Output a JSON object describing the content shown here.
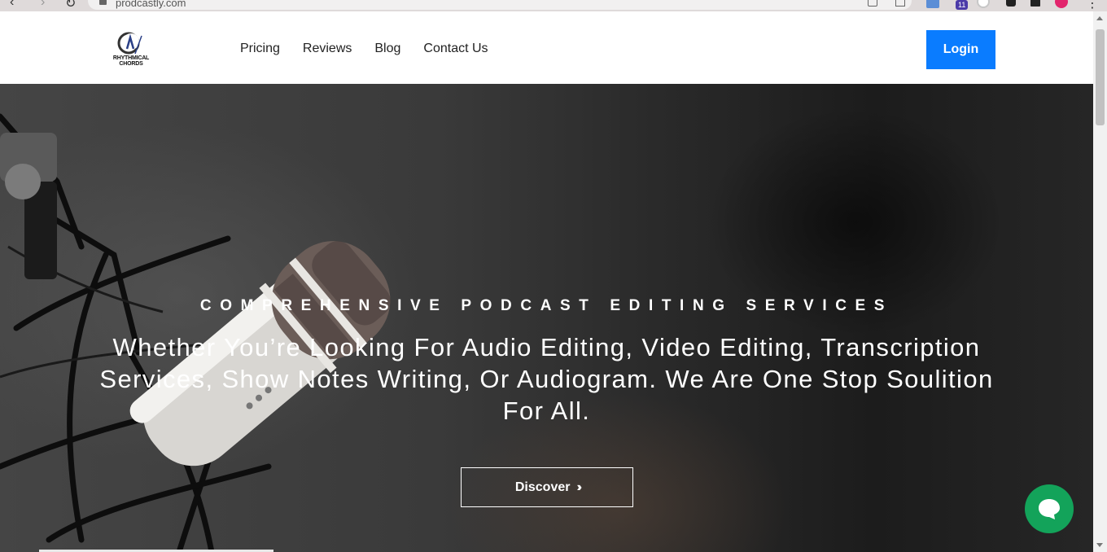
{
  "browser": {
    "url": "prodcastly.com",
    "extension_badge": "11"
  },
  "header": {
    "logo_text": "RHYTHMICAL CHORDS",
    "nav": [
      "Pricing",
      "Reviews",
      "Blog",
      "Contact Us"
    ],
    "login_label": "Login"
  },
  "hero": {
    "eyebrow": "COMPREHENSIVE PODCAST EDITING SERVICES",
    "headline": "Whether You’re Looking For Audio Editing, Video Editing, Transcription Services, Show Notes Writing, Or Audiogram. We Are One Stop Soulition For All.",
    "cta_label": "Discover",
    "cta_icon": "double-chevron-right-icon"
  },
  "chat": {
    "icon": "chat-bubble-icon"
  },
  "colors": {
    "login_bg": "#0a7cff",
    "chat_bg": "#13a35a",
    "chrome_bg": "#dfdada"
  }
}
